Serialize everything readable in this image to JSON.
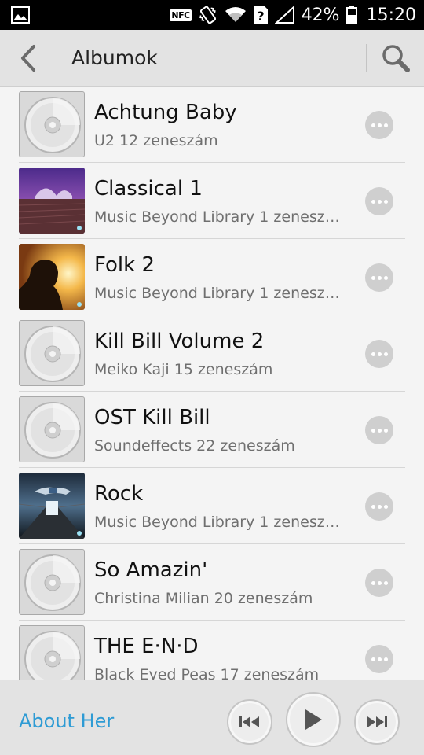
{
  "status_bar": {
    "battery_percent": "42%",
    "time": "15:20",
    "nfc_label": "NFC",
    "sim_label": "?",
    "icons": [
      "gallery-icon",
      "nfc-icon",
      "vibrate-icon",
      "wifi-icon",
      "sim-unknown-icon",
      "signal-icon",
      "battery-icon"
    ]
  },
  "header": {
    "title": "Albumok",
    "back_icon": "chevron-left-icon",
    "search_icon": "search-icon"
  },
  "albums": [
    {
      "title": "Achtung Baby",
      "subtitle": "U2  12 zeneszám",
      "art": "cd"
    },
    {
      "title": "Classical 1",
      "subtitle": "Music Beyond Library  1 zenesz…",
      "art": "opera-house"
    },
    {
      "title": "Folk 2",
      "subtitle": "Music Beyond Library  1 zenesz…",
      "art": "child-sunset"
    },
    {
      "title": "Kill Bill Volume 2",
      "subtitle": "Meiko Kaji  15 zeneszám",
      "art": "cd"
    },
    {
      "title": "OST Kill Bill",
      "subtitle": "Soundeffects  22 zeneszám",
      "art": "cd"
    },
    {
      "title": "Rock",
      "subtitle": "Music Beyond Library  1 zenesz…",
      "art": "floating-person"
    },
    {
      "title": "So Amazin'",
      "subtitle": "Christina Milian  20 zeneszám",
      "art": "cd"
    },
    {
      "title": "THE E·N·D",
      "subtitle": "Black Eyed Peas  17 zeneszám",
      "art": "cd"
    }
  ],
  "player": {
    "now_playing": "About Her",
    "controls": [
      "previous-icon",
      "play-icon",
      "next-icon"
    ]
  },
  "colors": {
    "accent": "#2e9bd4",
    "header_bg": "#e3e3e3",
    "list_bg": "#f4f4f4"
  }
}
